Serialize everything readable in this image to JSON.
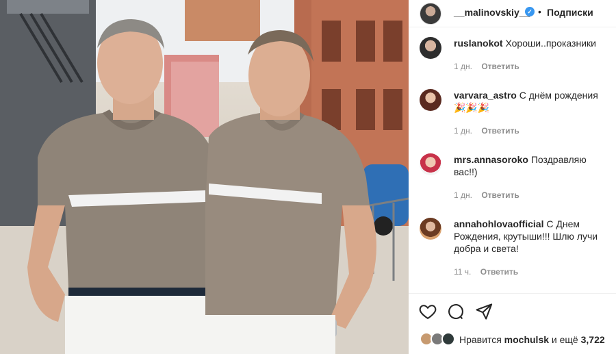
{
  "photo": {
    "alt_subject": ""
  },
  "header": {
    "username": "__malinovskiy__",
    "separator": "•",
    "follow_label": "Подписки"
  },
  "comments": [
    {
      "username": "ruslanokot",
      "text": "Хороши..проказники",
      "time": "1 дн.",
      "reply_label": "Ответить"
    },
    {
      "username": "varvara_astro",
      "text": "С днём рождения 🎉🎉🎉",
      "time": "1 дн.",
      "reply_label": "Ответить"
    },
    {
      "username": "mrs.annasoroko",
      "text": "Поздравляю вас!!)",
      "time": "1 дн.",
      "reply_label": "Ответить"
    },
    {
      "username": "annahohlovaofficial",
      "text": "С Днем Рождения, крутыши!!! Шлю лучи добра и света!",
      "time": "11 ч.",
      "reply_label": "Ответить"
    }
  ],
  "likes": {
    "prefix": "Нравится",
    "user": "mochulsk",
    "middle": "и ещё",
    "count": "3,722"
  },
  "icons": {
    "like": "heart-icon",
    "comment": "comment-icon",
    "share": "share-icon",
    "verified": "verified-badge-icon"
  },
  "colors": {
    "verified": "#3897f0",
    "meta": "#8e8e8e",
    "text": "#262626"
  }
}
